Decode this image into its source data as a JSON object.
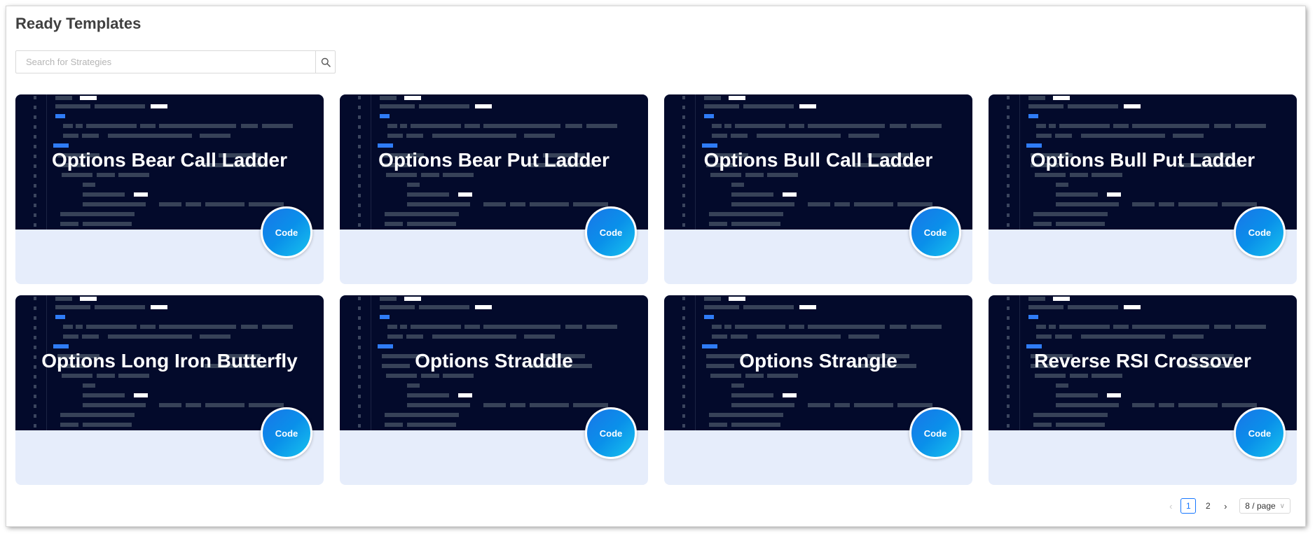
{
  "header": {
    "title": "Ready Templates"
  },
  "search": {
    "placeholder": "Search for Strategies",
    "value": ""
  },
  "cards": [
    {
      "title": "Options Bear Call Ladder",
      "button": "Code"
    },
    {
      "title": "Options Bear Put Ladder",
      "button": "Code"
    },
    {
      "title": "Options Bull Call Ladder",
      "button": "Code"
    },
    {
      "title": "Options Bull Put Ladder",
      "button": "Code"
    },
    {
      "title": "Options Long Iron Butterfly",
      "button": "Code"
    },
    {
      "title": "Options Straddle",
      "button": "Code"
    },
    {
      "title": "Options Strangle",
      "button": "Code"
    },
    {
      "title": "Reverse RSI Crossover",
      "button": "Code"
    }
  ],
  "pagination": {
    "prev_icon": "chevron-left-icon",
    "pages": [
      "1",
      "2"
    ],
    "current": "1",
    "next_icon": "chevron-right-icon",
    "page_size": "8 / page"
  },
  "colors": {
    "banner": "#030a2b",
    "card_body": "#e6edfb",
    "accent": "#1677ff"
  }
}
